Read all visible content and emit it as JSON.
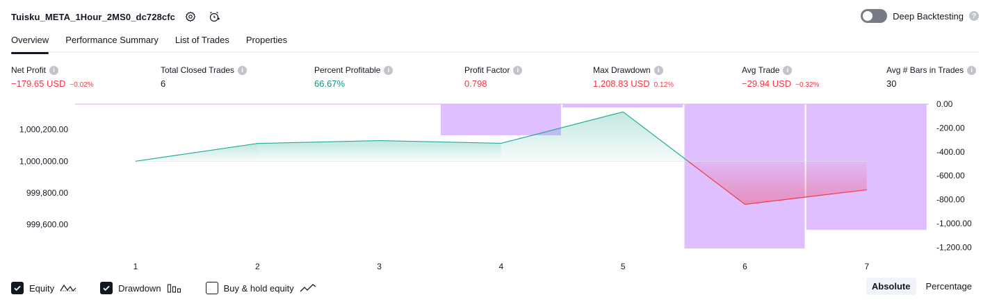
{
  "header": {
    "strategy_name": "Tuisku_META_1Hour_2MS0_dc728cfc",
    "deep_backtesting_label": "Deep Backtesting",
    "deep_backtesting_on": false
  },
  "tabs": [
    {
      "label": "Overview",
      "active": true
    },
    {
      "label": "Performance Summary",
      "active": false
    },
    {
      "label": "List of Trades",
      "active": false
    },
    {
      "label": "Properties",
      "active": false
    }
  ],
  "metrics": [
    {
      "label": "Net Profit",
      "value": "−179.65 USD",
      "pct": "−0.02%",
      "tone": "neg"
    },
    {
      "label": "Total Closed Trades",
      "value": "6",
      "pct": "",
      "tone": "neutral"
    },
    {
      "label": "Percent Profitable",
      "value": "66.67%",
      "pct": "",
      "tone": "pos"
    },
    {
      "label": "Profit Factor",
      "value": "0.798",
      "pct": "",
      "tone": "neg"
    },
    {
      "label": "Max Drawdown",
      "value": "1,208.83 USD",
      "pct": "0.12%",
      "tone": "neg"
    },
    {
      "label": "Avg Trade",
      "value": "−29.94 USD",
      "pct": "−0.32%",
      "tone": "neg"
    },
    {
      "label": "Avg # Bars in Trades",
      "value": "30",
      "pct": "",
      "tone": "neutral"
    }
  ],
  "chart_data": {
    "type": "line",
    "x": [
      1,
      2,
      3,
      4,
      5,
      6,
      7
    ],
    "x_tick_labels": [
      "1",
      "2",
      "3",
      "4",
      "5",
      "6",
      "7"
    ],
    "baseline": 1000000,
    "series": [
      {
        "name": "Equity",
        "axis": "left",
        "values": [
          1000000,
          1000112,
          1000130,
          1000113,
          1000311,
          999728,
          999820
        ]
      },
      {
        "name": "Drawdown",
        "axis": "right",
        "type": "bar",
        "values": [
          0,
          0,
          0,
          -261,
          -28,
          -1208.83,
          -1053
        ]
      }
    ],
    "left_axis": {
      "min": 999450,
      "max": 1000360,
      "ticks": [
        1000200,
        1000000,
        999800,
        999600
      ],
      "tick_labels": [
        "1,000,200.00",
        "1,000,000.00",
        "999,800.00",
        "999,600.00"
      ]
    },
    "right_axis": {
      "min": -1208.83,
      "max": 0,
      "ticks": [
        0,
        -200,
        -400,
        -600,
        -800,
        -1000,
        -1200
      ],
      "tick_labels": [
        "0.00",
        "-200.00",
        "-400.00",
        "-600.00",
        "-800.00",
        "-1,000.00",
        "-1,200.00"
      ]
    },
    "colors": {
      "equity_up": "#22ab94",
      "equity_down": "#f23645",
      "drawdown": "#d9b4ff",
      "drawdown_line": "#e0a3ef"
    }
  },
  "legend": [
    {
      "label": "Equity",
      "checked": true,
      "icon": "equity-line-icon"
    },
    {
      "label": "Drawdown",
      "checked": true,
      "icon": "drawdown-bars-icon"
    },
    {
      "label": "Buy & hold equity",
      "checked": false,
      "icon": "buy-hold-line-icon"
    }
  ],
  "view_mode": {
    "absolute_label": "Absolute",
    "percentage_label": "Percentage",
    "selected": "Absolute"
  }
}
